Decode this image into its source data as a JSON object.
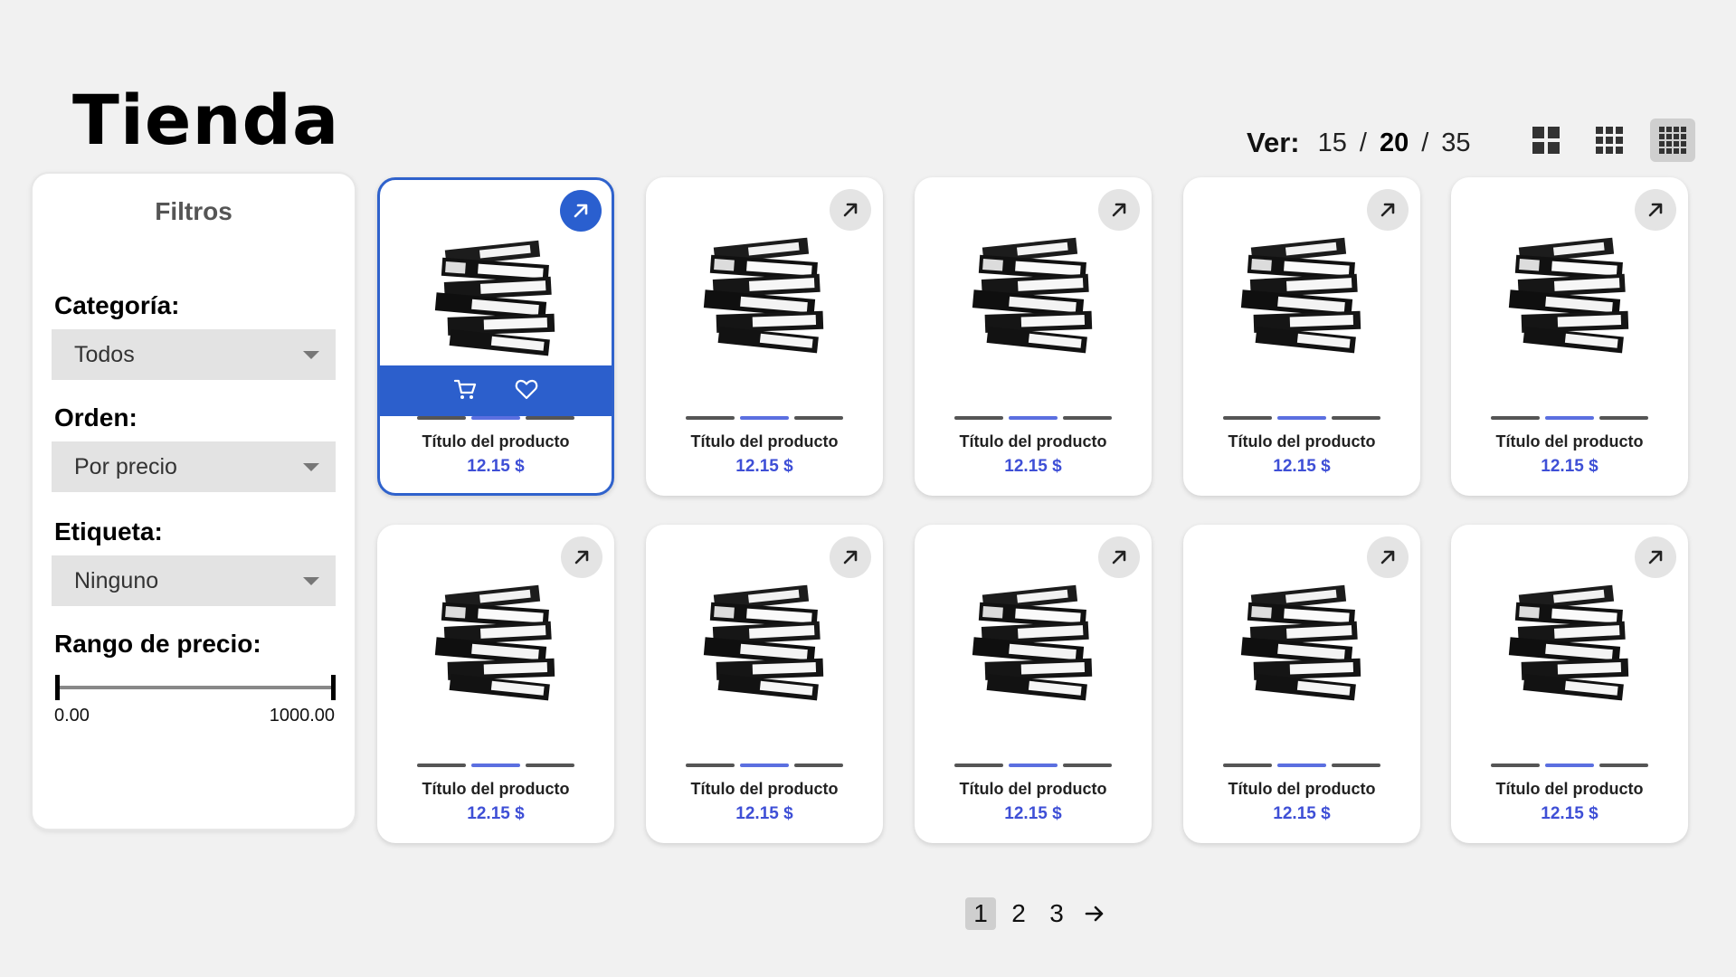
{
  "page": {
    "title": "Tienda"
  },
  "view": {
    "label": "Ver:",
    "options": [
      "15",
      "20",
      "35"
    ],
    "selected": "20",
    "separator": "/"
  },
  "grid_modes": [
    {
      "name": "grid-2x2-icon",
      "active": false
    },
    {
      "name": "grid-3x3-icon",
      "active": false
    },
    {
      "name": "grid-4x4-icon",
      "active": true
    }
  ],
  "filters": {
    "title": "Filtros",
    "category": {
      "label": "Categoría:",
      "value": "Todos"
    },
    "order": {
      "label": "Orden:",
      "value": "Por precio"
    },
    "tag": {
      "label": "Etiqueta:",
      "value": "Ninguno"
    },
    "price_range": {
      "label": "Rango de precio:",
      "min": "0.00",
      "max": "1000.00"
    }
  },
  "products": [
    {
      "title": "Título del producto",
      "price": "12.15 $",
      "selected": true
    },
    {
      "title": "Título del producto",
      "price": "12.15 $"
    },
    {
      "title": "Título del producto",
      "price": "12.15 $"
    },
    {
      "title": "Título del producto",
      "price": "12.15 $"
    },
    {
      "title": "Título del producto",
      "price": "12.15 $"
    },
    {
      "title": "Título del producto",
      "price": "12.15 $"
    },
    {
      "title": "Título del producto",
      "price": "12.15 $"
    },
    {
      "title": "Título del producto",
      "price": "12.15 $"
    },
    {
      "title": "Título del producto",
      "price": "12.15 $"
    },
    {
      "title": "Título del producto",
      "price": "12.15 $"
    }
  ],
  "pagination": {
    "pages": [
      "1",
      "2",
      "3"
    ],
    "current": "1"
  },
  "colors": {
    "accent": "#2c5fcc",
    "price": "#3e4fd6",
    "background": "#f1f1f1"
  }
}
